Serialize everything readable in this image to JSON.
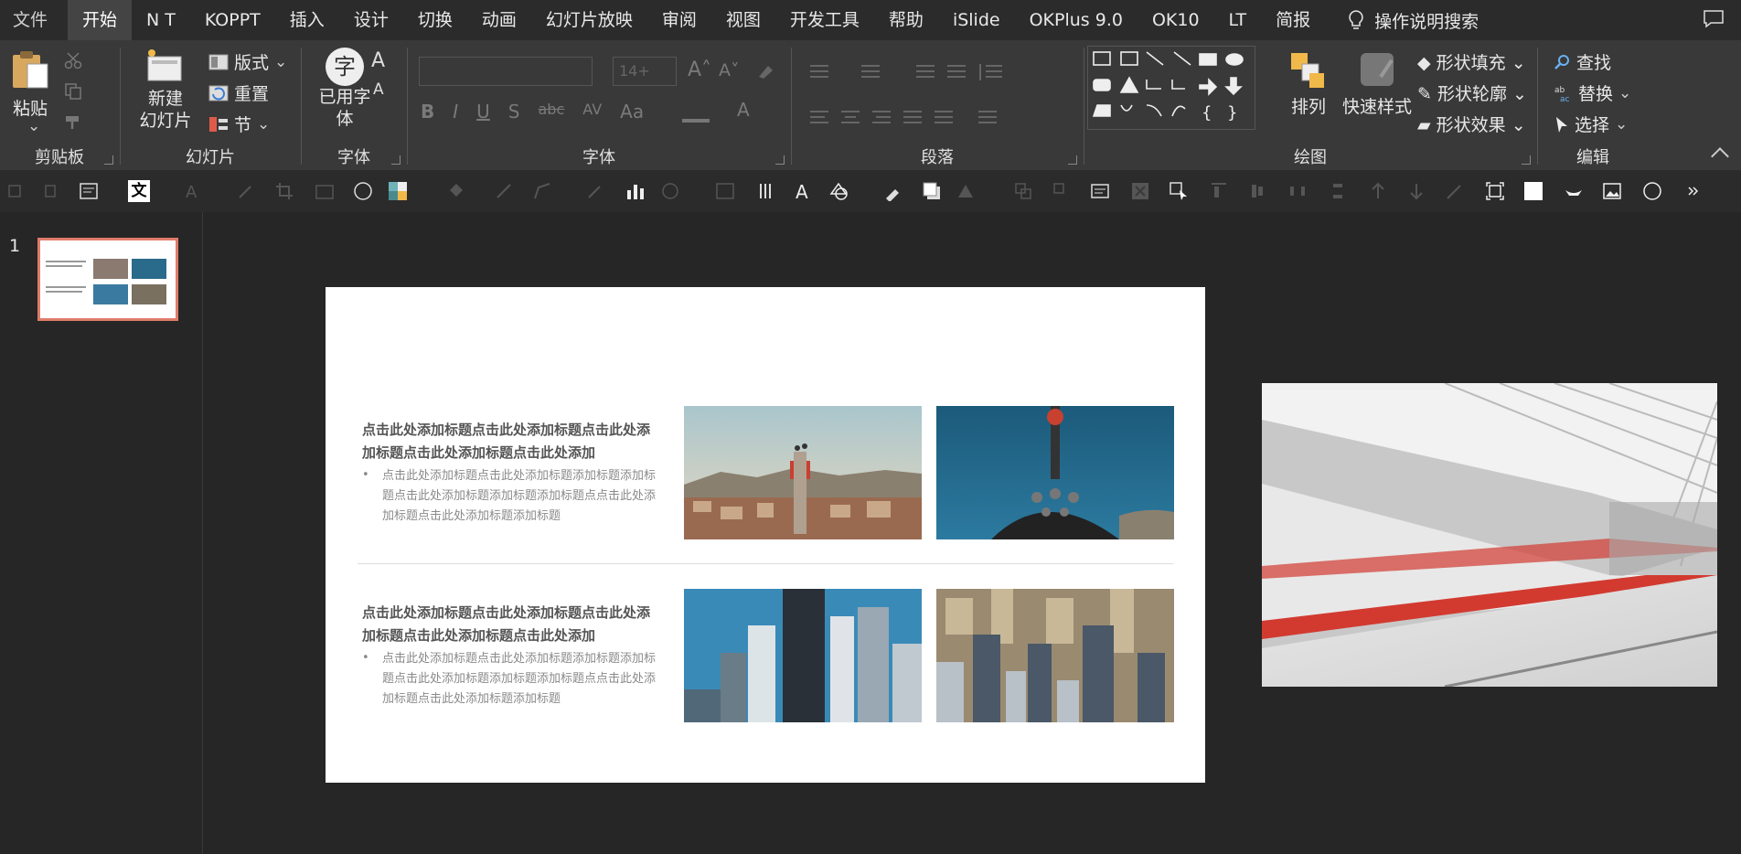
{
  "menu": {
    "tabs": [
      "文件",
      "开始",
      "N T",
      "KOPPT",
      "插入",
      "设计",
      "切换",
      "动画",
      "幻灯片放映",
      "审阅",
      "视图",
      "开发工具",
      "帮助",
      "iSlide",
      "OKPlus 9.0",
      "OK10",
      "LT",
      "简报"
    ],
    "active_index": 1,
    "search_label": "操作说明搜索"
  },
  "ribbon": {
    "clipboard": {
      "paste": "粘贴",
      "group": "剪贴板"
    },
    "slides": {
      "new_slide": "新建\n幻灯片",
      "new_slide_l1": "新建",
      "new_slide_l2": "幻灯片",
      "layout": "版式",
      "reset": "重置",
      "section": "节",
      "group": "幻灯片"
    },
    "font_ui": {
      "used_font_l1": "已用字",
      "used_font_l2": "体",
      "group": "字体",
      "glyph": "字"
    },
    "font": {
      "font_size": "14+",
      "group": "字体"
    },
    "paragraph": {
      "group": "段落"
    },
    "drawing": {
      "arrange": "排列",
      "quick_styles": "快速样式",
      "shape_fill": "形状填充",
      "shape_outline": "形状轮廓",
      "shape_effect": "形状效果",
      "group": "绘图"
    },
    "editing": {
      "find": "查找",
      "replace": "替换",
      "select": "选择",
      "group": "编辑"
    }
  },
  "thumbnails": {
    "slide_number": "1"
  },
  "slide": {
    "rows": [
      {
        "title": "点击此处添加标题点击此处添加标题点击此处添加标题点击此处添加标题点击此处添加",
        "body": "点击此处添加标题点击此处添加标题添加标题添加标题点击此处添加标题添加标题添加标题点点击此处添加标题点击此处添加标题添加标题"
      },
      {
        "title": "点击此处添加标题点击此处添加标题点击此处添加标题点击此处添加标题点击此处添加",
        "body": "点击此处添加标题点击此处添加标题添加标题添加标题点击此处添加标题添加标题添加标题点点击此处添加标题点击此处添加标题添加标题"
      }
    ]
  },
  "colors": {
    "accent_thumb_border": "#e07c6b",
    "menubar_bg": "#2b2b2b",
    "ribbon_bg": "#393939",
    "workspace_bg": "#262626",
    "active_tab_bg": "#444444"
  }
}
